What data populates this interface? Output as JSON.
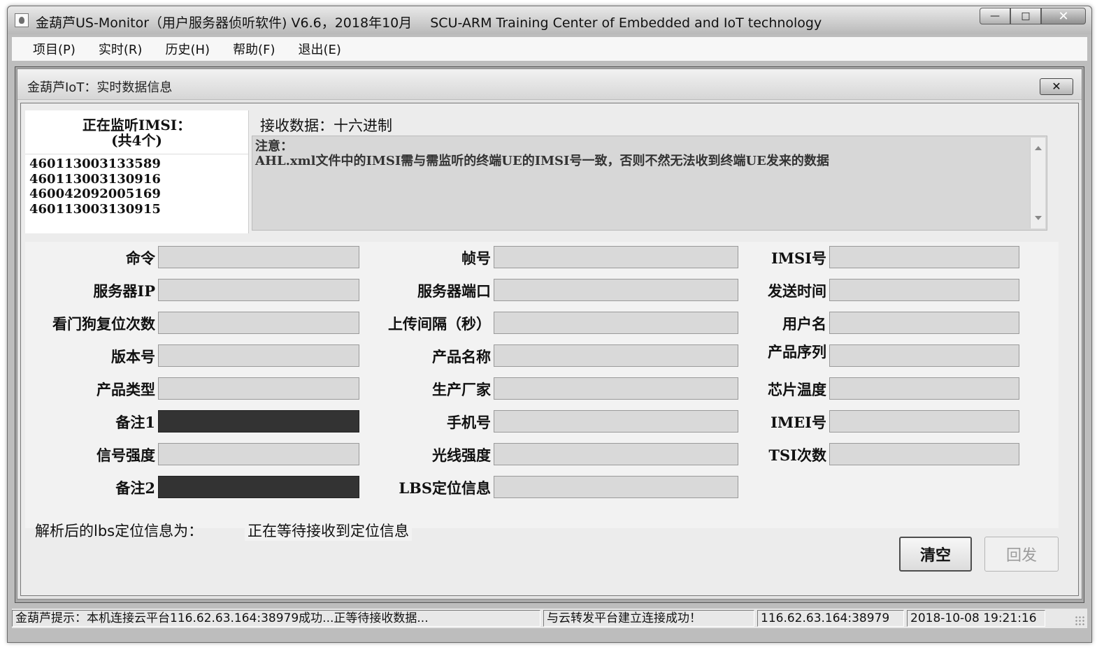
{
  "window": {
    "title": "金葫芦US-Monitor（用户服务器侦听软件) V6.6，2018年10月",
    "org": "SCU-ARM Training Center of Embedded and IoT technology",
    "min_label": "—",
    "max_label": "□",
    "close_label": "✕"
  },
  "menu": [
    {
      "label": "项目(P)"
    },
    {
      "label": "实时(R)"
    },
    {
      "label": "历史(H)"
    },
    {
      "label": "帮助(F)"
    },
    {
      "label": "退出(E)"
    }
  ],
  "child": {
    "title": "金葫芦IoT：实时数据信息",
    "close_label": "✕"
  },
  "imsi": {
    "title_line1": "正在监听IMSI：",
    "title_line2": "(共4个)",
    "items": [
      "460113003133589",
      "460113003130916",
      "460042092005169",
      "460113003130915"
    ]
  },
  "receive": {
    "label": "接收数据：十六进制",
    "note_line1": "注意：",
    "note_line2": "AHL.xml文件中的IMSI需与需监听的终端UE的IMSI号一致，否则不然无法收到终端UE发来的数据"
  },
  "fields": {
    "col1": [
      "命令",
      "服务器IP",
      "看门狗复位次数",
      "版本号",
      "产品类型",
      "备注1",
      "信号强度",
      "备注2"
    ],
    "col2": [
      "帧号",
      "服务器端口",
      "上传间隔（秒）",
      "产品名称",
      "生产厂家",
      "手机号",
      "光线强度",
      "LBS定位信息"
    ],
    "col3": [
      "IMSI号",
      "发送时间",
      "用户名",
      "产品序列",
      "芯片温度",
      "IMEI号",
      "TSI次数"
    ]
  },
  "lbs": {
    "label": "解析后的lbs定位信息为：",
    "value": "正在等待接收到定位信息"
  },
  "buttons": {
    "clear": "清空",
    "reply": "回发"
  },
  "status": {
    "hint": "金葫芦提示：本机连接云平台116.62.63.164:38979成功...正等待接收数据...",
    "cloud": "与云转发平台建立连接成功！",
    "address": "116.62.63.164:38979",
    "time": "2018-10-08 19:21:16"
  },
  "colors": {
    "dark_field": "#333333",
    "light_field": "#d9d9d9"
  }
}
